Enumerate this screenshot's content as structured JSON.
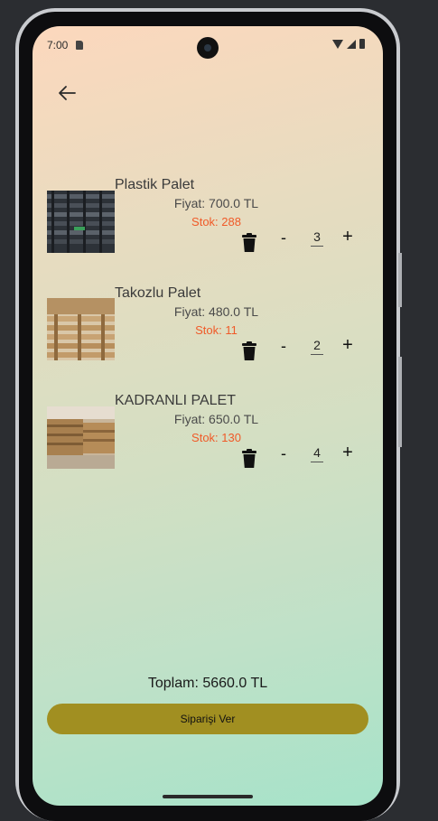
{
  "status_bar": {
    "time": "7:00"
  },
  "nav": {
    "back_icon": "arrow-left-icon"
  },
  "cart": {
    "items": [
      {
        "name": "Plastik Palet",
        "price": "Fiyat: 700.0 TL",
        "stock": "Stok: 288",
        "quantity": "3",
        "minus_label": "-",
        "plus_label": "+"
      },
      {
        "name": "Takozlu Palet",
        "price": "Fiyat: 480.0 TL",
        "stock": "Stok: 11",
        "quantity": "2",
        "minus_label": "-",
        "plus_label": "+"
      },
      {
        "name": "KADRANLI PALET",
        "price": "Fiyat: 650.0 TL",
        "stock": "Stok: 130",
        "quantity": "4",
        "minus_label": "-",
        "plus_label": "+"
      }
    ]
  },
  "summary": {
    "total": "Toplam: 5660.0 TL"
  },
  "actions": {
    "order_label": "Siparişi Ver"
  },
  "colors": {
    "accent": "#a18f21",
    "stock_text": "#f05a28",
    "gradient_top": "#fcd8bd",
    "gradient_bottom": "#a6e3c9"
  }
}
